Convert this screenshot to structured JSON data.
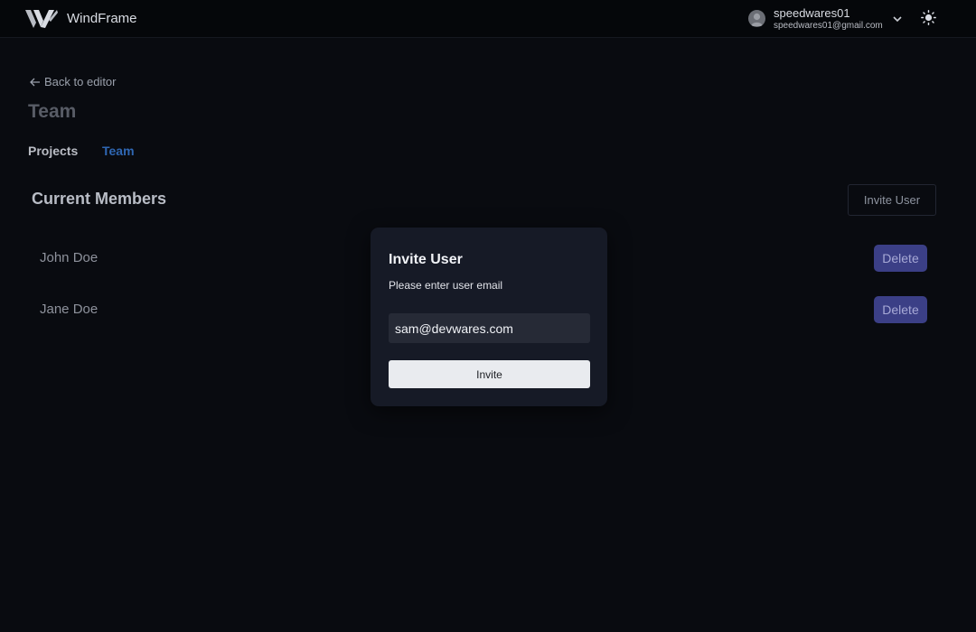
{
  "header": {
    "brand": "WindFrame",
    "logo_icon": "windframe-logo-icon",
    "user": {
      "name": "speedwares01",
      "email": "speedwares01@gmail.com"
    },
    "dropdown_icon": "chevron-down-icon",
    "theme_icon": "sun-icon"
  },
  "page": {
    "back_label": "Back to editor",
    "title": "Team",
    "tabs": [
      {
        "label": "Projects",
        "active": false
      },
      {
        "label": "Team",
        "active": true
      }
    ]
  },
  "members": {
    "title": "Current Members",
    "invite_button": "Invite User",
    "list": [
      {
        "name": "John Doe",
        "action": "Delete"
      },
      {
        "name": "Jane Doe",
        "action": "Delete"
      }
    ]
  },
  "modal": {
    "title": "Invite User",
    "subtitle": "Please enter user email",
    "email_value": "sam@devwares.com",
    "submit_label": "Invite"
  },
  "colors": {
    "background": "#090b10",
    "accent_tab": "#2f67b3",
    "delete_button": "#3b3f86",
    "modal_bg": "#161a26"
  }
}
